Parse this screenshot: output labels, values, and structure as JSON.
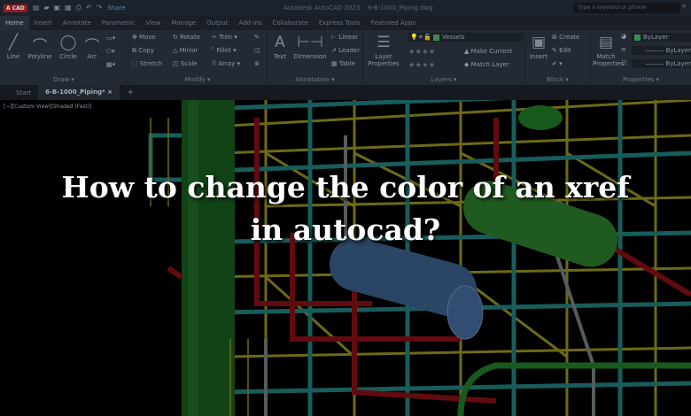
{
  "titlebar": {
    "logo": "A CAD",
    "share": "Share",
    "title": "Autodesk AutoCAD 2023",
    "file": "6-B-1000_Piping.dwg",
    "search_placeholder": "Type a keyword or phrase"
  },
  "ribbon_tabs": [
    "Home",
    "Insert",
    "Annotate",
    "Parametric",
    "View",
    "Manage",
    "Output",
    "Add-ins",
    "Collaborate",
    "Express Tools",
    "Featured Apps"
  ],
  "draw": {
    "label": "Draw ▾",
    "line": "Line",
    "polyline": "Polyline",
    "circle": "Circle",
    "arc": "Arc"
  },
  "modify": {
    "label": "Modify ▾",
    "move": "Move",
    "rotate": "Rotate",
    "trim": "Trim",
    "copy": "Copy",
    "mirror": "Mirror",
    "fillet": "Fillet",
    "stretch": "Stretch",
    "scale": "Scale",
    "array": "Array"
  },
  "annotation": {
    "label": "Annotation ▾",
    "text": "Text",
    "dimension": "Dimension",
    "linear": "Linear",
    "leader": "Leader",
    "table": "Table"
  },
  "layers": {
    "label": "Layers ▾",
    "layer_properties": "Layer Properties",
    "current_layer": "Vessels",
    "make_current": "Make Current",
    "match_layer": "Match Layer"
  },
  "block": {
    "label": "Block ▾",
    "insert": "Insert",
    "create": "Create",
    "edit": "Edit"
  },
  "properties": {
    "label": "Properties ▾",
    "match": "Match Properties",
    "color": "ByLayer",
    "linetype": "ByLayer",
    "lineweight": "ByLayer"
  },
  "file_tabs": {
    "start": "Start",
    "active": "6-B-1000_Piping*",
    "close": "×",
    "add": "+"
  },
  "viewport": {
    "label": "[−][Custom View][Shaded (Fast)]"
  },
  "headline": {
    "line1": "How to change the color of an xref",
    "line2": "in autocad?"
  }
}
